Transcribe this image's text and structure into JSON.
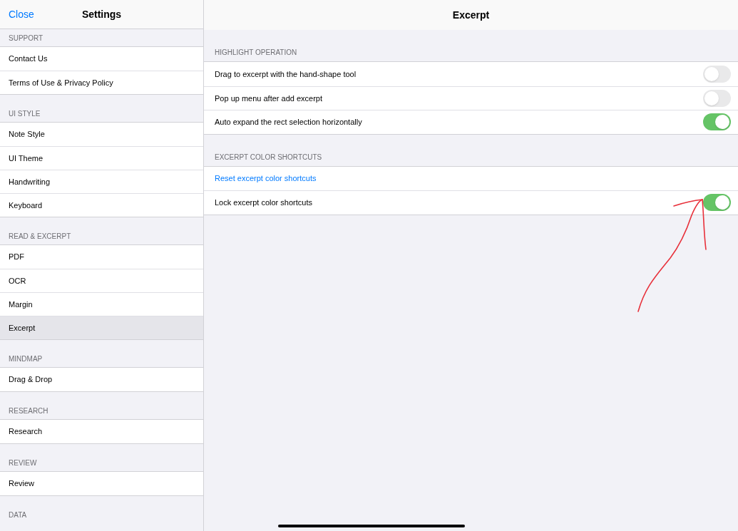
{
  "sidebar": {
    "close": "Close",
    "title": "Settings",
    "sections": [
      {
        "header": "SUPPORT",
        "items": [
          {
            "label": "Contact Us",
            "selected": false
          },
          {
            "label": "Terms of Use & Privacy Policy",
            "selected": false
          }
        ]
      },
      {
        "header": "UI STYLE",
        "items": [
          {
            "label": "Note Style",
            "selected": false
          },
          {
            "label": "UI Theme",
            "selected": false
          },
          {
            "label": "Handwriting",
            "selected": false
          },
          {
            "label": "Keyboard",
            "selected": false
          }
        ]
      },
      {
        "header": "READ & EXCERPT",
        "items": [
          {
            "label": "PDF",
            "selected": false
          },
          {
            "label": "OCR",
            "selected": false
          },
          {
            "label": "Margin",
            "selected": false
          },
          {
            "label": "Excerpt",
            "selected": true
          }
        ]
      },
      {
        "header": "MINDMAP",
        "items": [
          {
            "label": "Drag & Drop",
            "selected": false
          }
        ]
      },
      {
        "header": "RESEARCH",
        "items": [
          {
            "label": "Research",
            "selected": false
          }
        ]
      },
      {
        "header": "REVIEW",
        "items": [
          {
            "label": "Review",
            "selected": false
          }
        ]
      },
      {
        "header": "DATA"
      }
    ]
  },
  "detail": {
    "title": "Excerpt",
    "sections": [
      {
        "header": "HIGHLIGHT OPERATION",
        "rows": [
          {
            "kind": "toggle",
            "label": "Drag to excerpt with the hand-shape tool",
            "on": false
          },
          {
            "kind": "toggle",
            "label": "Pop up menu after add excerpt",
            "on": false
          },
          {
            "kind": "toggle",
            "label": "Auto expand the rect selection horizontally",
            "on": true
          }
        ]
      },
      {
        "header": "EXCERPT COLOR SHORTCUTS",
        "rows": [
          {
            "kind": "link",
            "label": "Reset excerpt color shortcuts"
          },
          {
            "kind": "toggle",
            "label": "Lock excerpt color shortcuts",
            "on": true
          }
        ]
      }
    ]
  }
}
